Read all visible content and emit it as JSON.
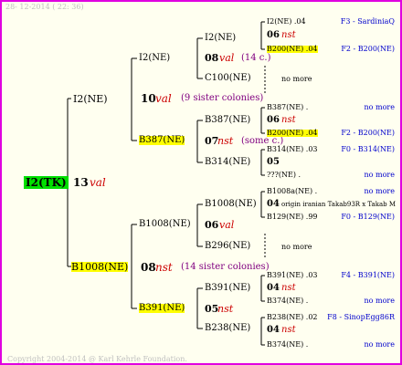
{
  "timestamp": "28- 12-2014 ( 22: 36)",
  "copyright": "Copyright 2004-2014 @ Karl Kehrle Foundation.",
  "nomore": "no more",
  "root": {
    "label": "I2(TK)",
    "num": "13",
    "status": "val"
  },
  "g1a": {
    "label": "I2(NE)",
    "num": "10",
    "status": "val",
    "colonies": "(9 sister colonies)"
  },
  "g1b": {
    "label": "B1008(NE)",
    "num": "08",
    "status": "nst",
    "colonies": "(14 sister colonies)"
  },
  "g2": [
    {
      "label": "I2(NE)",
      "num": "08",
      "status": "val",
      "note": "(14 c.)"
    },
    {
      "label": "B387(NE)",
      "num": "07",
      "status": "nst",
      "note": "(some c.)"
    },
    {
      "label": "B1008(NE)",
      "num": "06",
      "status": "val"
    },
    {
      "label": "B391(NE)",
      "num": "05",
      "status": "nst"
    }
  ],
  "g3": [
    "I2(NE)",
    "C100(NE)",
    "B387(NE)",
    "B314(NE)",
    "B1008(NE)",
    "B296(NE)",
    "B391(NE)",
    "B238(NE)"
  ],
  "g3n": [
    {
      "num": "06",
      "status": "nst"
    },
    {
      "num": "06",
      "status": "nst"
    },
    {
      "num": "05"
    },
    {
      "num": "04",
      "note": "origin iranian Takab93R x Takab M"
    },
    {
      "num": "04",
      "status": "nst"
    },
    {
      "num": "04",
      "status": "nst"
    }
  ],
  "g4": [
    {
      "label": "I2(NE) .04",
      "right": "F3 - SardiniaQ",
      "hl": false
    },
    {
      "label": "B200(NE) .04",
      "right": "F2 - B200(NE)",
      "hl": true
    },
    {
      "label": "B387(NE) .",
      "right": "no more",
      "hl": false
    },
    {
      "label": "B200(NE) .04",
      "right": "F2 - B200(NE)",
      "hl": true
    },
    {
      "label": "B314(NE) .03",
      "right": "F0 - B314(NE)",
      "hl": false
    },
    {
      "label": "???(NE) .",
      "right": "no more",
      "hl": false
    },
    {
      "label": "B1008a(NE) .",
      "right": "no more",
      "hl": false
    },
    {
      "label": "B129(NE) .99",
      "right": "F0 - B129(NE)",
      "hl": false
    },
    {
      "label": "B391(NE) .03",
      "right": "F4 - B391(NE)",
      "hl": false
    },
    {
      "label": "B374(NE) .",
      "right": "no more",
      "hl": false
    },
    {
      "label": "B238(NE) .02",
      "right": "F8 - SinopEgg86R",
      "hl": false
    },
    {
      "label": "B374(NE) .",
      "right": "no more",
      "hl": false
    }
  ]
}
